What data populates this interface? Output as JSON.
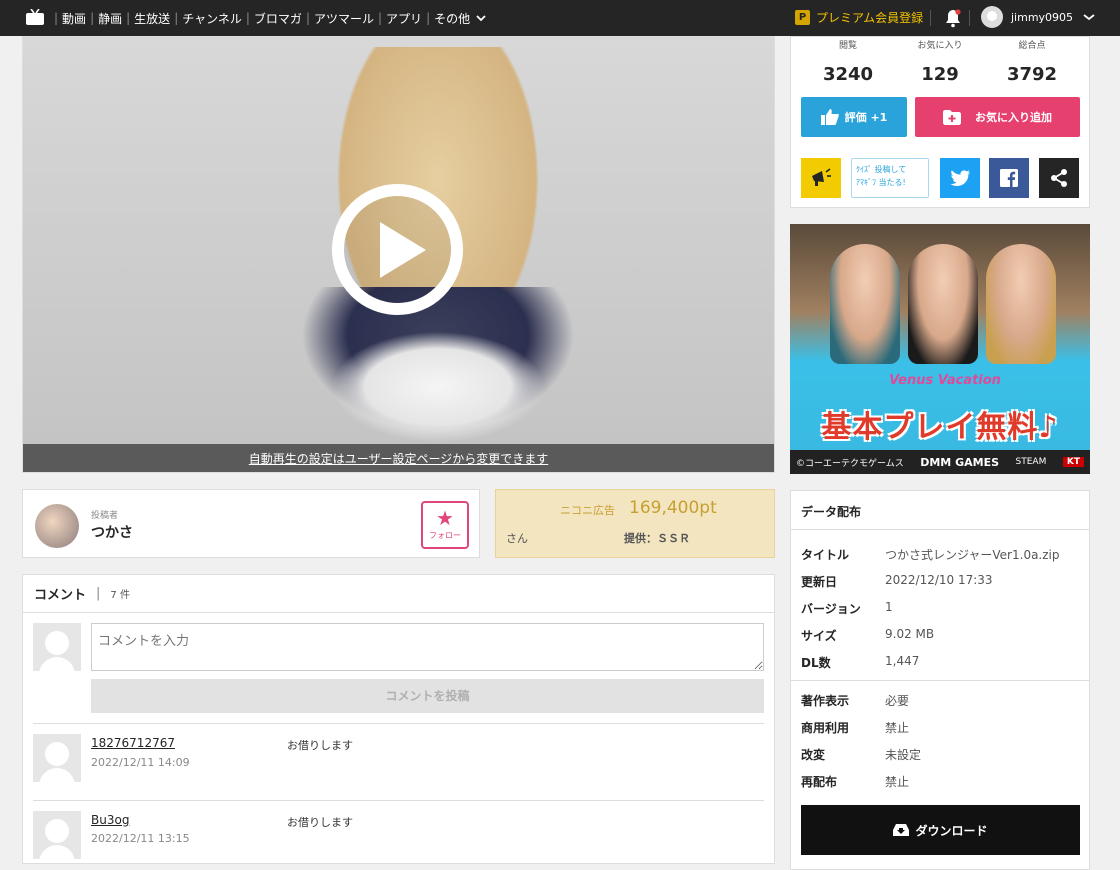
{
  "nav": {
    "items": [
      "動画",
      "静画",
      "生放送",
      "チャンネル",
      "ブロマガ",
      "アツマール",
      "アプリ",
      "その他"
    ],
    "premium_label": "プレミアム会員登録",
    "username": "jimmy0905"
  },
  "player": {
    "autoplay_notice": "自動再生の設定はユーザー設定ページから変更できます"
  },
  "owner": {
    "label": "投稿者",
    "name": "つかさ",
    "follow_label": "フォロー"
  },
  "ad": {
    "label": "ニコニ広告",
    "points": "169,400pt",
    "sponsor_fragment": "さん",
    "provider": "提供：ＳＳＲ"
  },
  "comments": {
    "title": "コメント",
    "count": "7 件",
    "input_placeholder": "コメントを入力",
    "post_label": "コメントを投稿",
    "items": [
      {
        "user": "18276712767",
        "date": "2022/12/11 14:09",
        "text": "お借りします"
      },
      {
        "user": "Bu3og",
        "date": "2022/12/11 13:15",
        "text": "お借りします"
      }
    ]
  },
  "stats": {
    "views_label": "閲覧",
    "views": "3240",
    "fav_label": "お気に入り",
    "fav": "129",
    "total_label": "総合点",
    "total": "3792",
    "eval_label": "評価 +1",
    "fav_add_label": "お気に入り追加",
    "quiz_line1": "ｸｲｽﾞ 投稿して",
    "quiz_line2": "ｱﾏｷﾞﾌ 当たる!"
  },
  "banner": {
    "logo": "Venus Vacation",
    "headline": "基本プレイ無料♪",
    "copyright": "©コーエーテクモゲームス",
    "dmm": "DMM GAMES",
    "steam": "STEAM",
    "kt": "KT"
  },
  "distribution": {
    "title": "データ配布",
    "rows": [
      {
        "k": "タイトル",
        "v": "つかさ式レンジャーVer1.0a.zip"
      },
      {
        "k": "更新日",
        "v": "2022/12/10 17:33"
      },
      {
        "k": "バージョン",
        "v": "1"
      },
      {
        "k": "サイズ",
        "v": "9.02 MB"
      },
      {
        "k": "DL数",
        "v": "1,447"
      }
    ],
    "rows2": [
      {
        "k": "著作表示",
        "v": "必要"
      },
      {
        "k": "商用利用",
        "v": "禁止"
      },
      {
        "k": "改変",
        "v": "未設定"
      },
      {
        "k": "再配布",
        "v": "禁止"
      }
    ],
    "download_label": "ダウンロード"
  },
  "colors": {
    "topbar": "#252525",
    "accent_blue": "#29a3da",
    "accent_pink": "#e6406f",
    "twitter": "#1da1f2",
    "facebook": "#3b5998"
  }
}
